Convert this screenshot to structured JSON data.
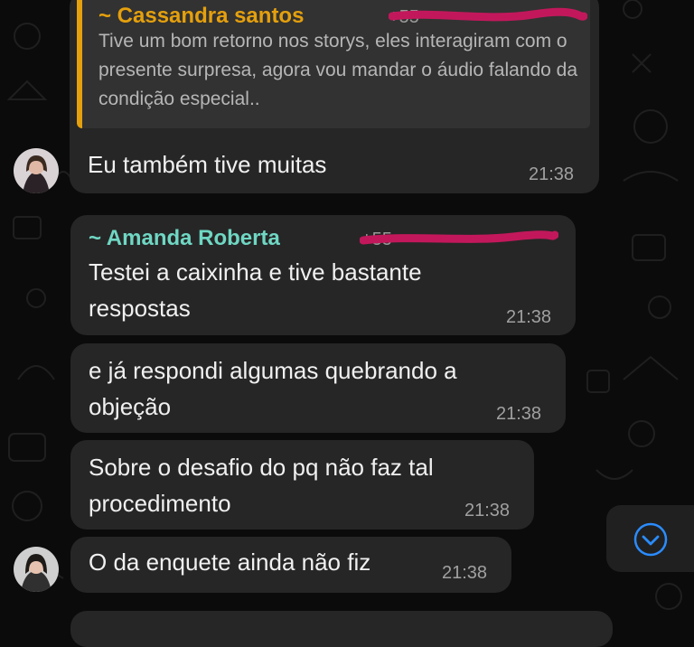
{
  "messages": [
    {
      "quote": {
        "author": "~ Cassandra santos",
        "phone": "+55",
        "text": "Tive um bom retorno nos storys, eles interagiram com o presente surpresa, agora vou mandar o áudio falando da condição especial.."
      },
      "text": "Eu também tive muitas",
      "time": "21:38"
    },
    {
      "sender": "~ Amanda Roberta",
      "phone": "+55",
      "text": "Testei a caixinha e tive bastante respostas",
      "time": "21:38"
    },
    {
      "text": "e já respondi algumas quebrando a objeção",
      "time": "21:38"
    },
    {
      "text": "Sobre o desafio do pq não faz tal procedimento",
      "time": "21:38"
    },
    {
      "text": "O da enquete ainda não fiz",
      "time": "21:38"
    }
  ],
  "colors": {
    "cassandra_name": "#e5a00d",
    "amanda_name": "#6fd7c3",
    "bubble": "#262626",
    "quote_bg": "#323232",
    "redaction": "#c2185b",
    "scroll_icon": "#2a8cff"
  },
  "icons": {
    "scroll_down": "chevron-down-circle-icon",
    "wallpaper": "doodle-pattern"
  }
}
